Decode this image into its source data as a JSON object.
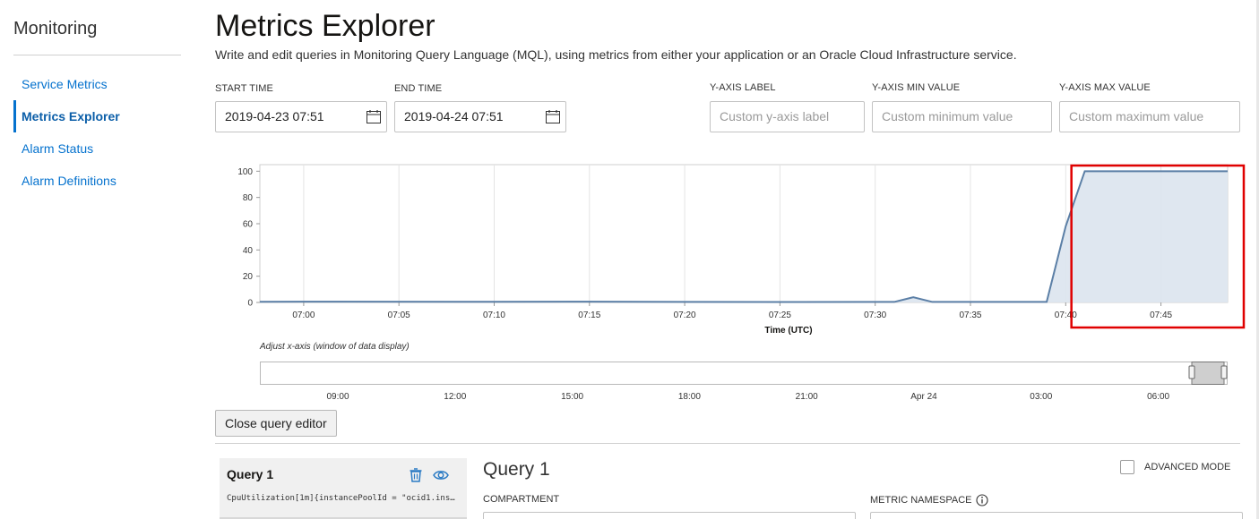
{
  "sidebar": {
    "title": "Monitoring",
    "items": [
      {
        "label": "Service Metrics",
        "active": false
      },
      {
        "label": "Metrics Explorer",
        "active": true
      },
      {
        "label": "Alarm Status",
        "active": false
      },
      {
        "label": "Alarm Definitions",
        "active": false
      }
    ]
  },
  "header": {
    "title": "Metrics Explorer",
    "subtitle": "Write and edit queries in Monitoring Query Language (MQL), using metrics from either your application or an Oracle Cloud Infrastructure service."
  },
  "filters": {
    "start_time_label": "START TIME",
    "start_time_value": "2019-04-23 07:51",
    "end_time_label": "END TIME",
    "end_time_value": "2019-04-24 07:51",
    "y_axis_label_label": "Y-AXIS LABEL",
    "y_axis_label_placeholder": "Custom y-axis label",
    "y_axis_min_label": "Y-AXIS MIN VALUE",
    "y_axis_min_placeholder": "Custom minimum value",
    "y_axis_max_label": "Y-AXIS MAX VALUE",
    "y_axis_max_placeholder": "Custom maximum value"
  },
  "chart_data": {
    "type": "area",
    "title": "",
    "xlabel": "Time (UTC)",
    "ylabel": "",
    "ylim": [
      0,
      105
    ],
    "yticks": [
      0,
      20,
      40,
      60,
      80,
      100
    ],
    "xlim": [
      "06:57.7",
      "07:48.5"
    ],
    "x_ticks": [
      "07:00",
      "07:05",
      "07:10",
      "07:15",
      "07:20",
      "07:25",
      "07:30",
      "07:35",
      "07:40",
      "07:45"
    ],
    "grid": true,
    "series": [
      {
        "values": [
          {
            "x": "06:57.7",
            "y": 0.5
          },
          {
            "x": "07:00",
            "y": 0.6
          },
          {
            "x": "07:10",
            "y": 0.5
          },
          {
            "x": "07:15",
            "y": 0.6
          },
          {
            "x": "07:20",
            "y": 0.4
          },
          {
            "x": "07:25",
            "y": 0.3
          },
          {
            "x": "07:31",
            "y": 0.4
          },
          {
            "x": "07:32",
            "y": 4
          },
          {
            "x": "07:33",
            "y": 0.4
          },
          {
            "x": "07:39",
            "y": 0.4
          },
          {
            "x": "07:40",
            "y": 58
          },
          {
            "x": "07:41",
            "y": 100
          },
          {
            "x": "07:48.5",
            "y": 100
          }
        ]
      }
    ],
    "colors": {
      "line": "#5b7fa6",
      "fill": "#dbe4ee",
      "highlight": "#e00000"
    }
  },
  "navigator": {
    "label": "Adjust x-axis (window of data display)",
    "ticks": [
      "09:00",
      "12:00",
      "15:00",
      "18:00",
      "21:00",
      "Apr 24",
      "03:00",
      "06:00"
    ]
  },
  "close_button_label": "Close query editor",
  "query": {
    "card_title": "Query 1",
    "card_text": "CpuUtilization[1m]{instancePoolId = \"ocid1.ins…",
    "heading": "Query 1",
    "advanced_mode_label": "ADVANCED MODE",
    "compartment_label": "COMPARTMENT",
    "metric_namespace_label": "METRIC NAMESPACE"
  },
  "icons": {
    "calendar": "calendar-icon",
    "delete": "trash-icon",
    "view": "eye-icon",
    "info": "info-icon"
  }
}
